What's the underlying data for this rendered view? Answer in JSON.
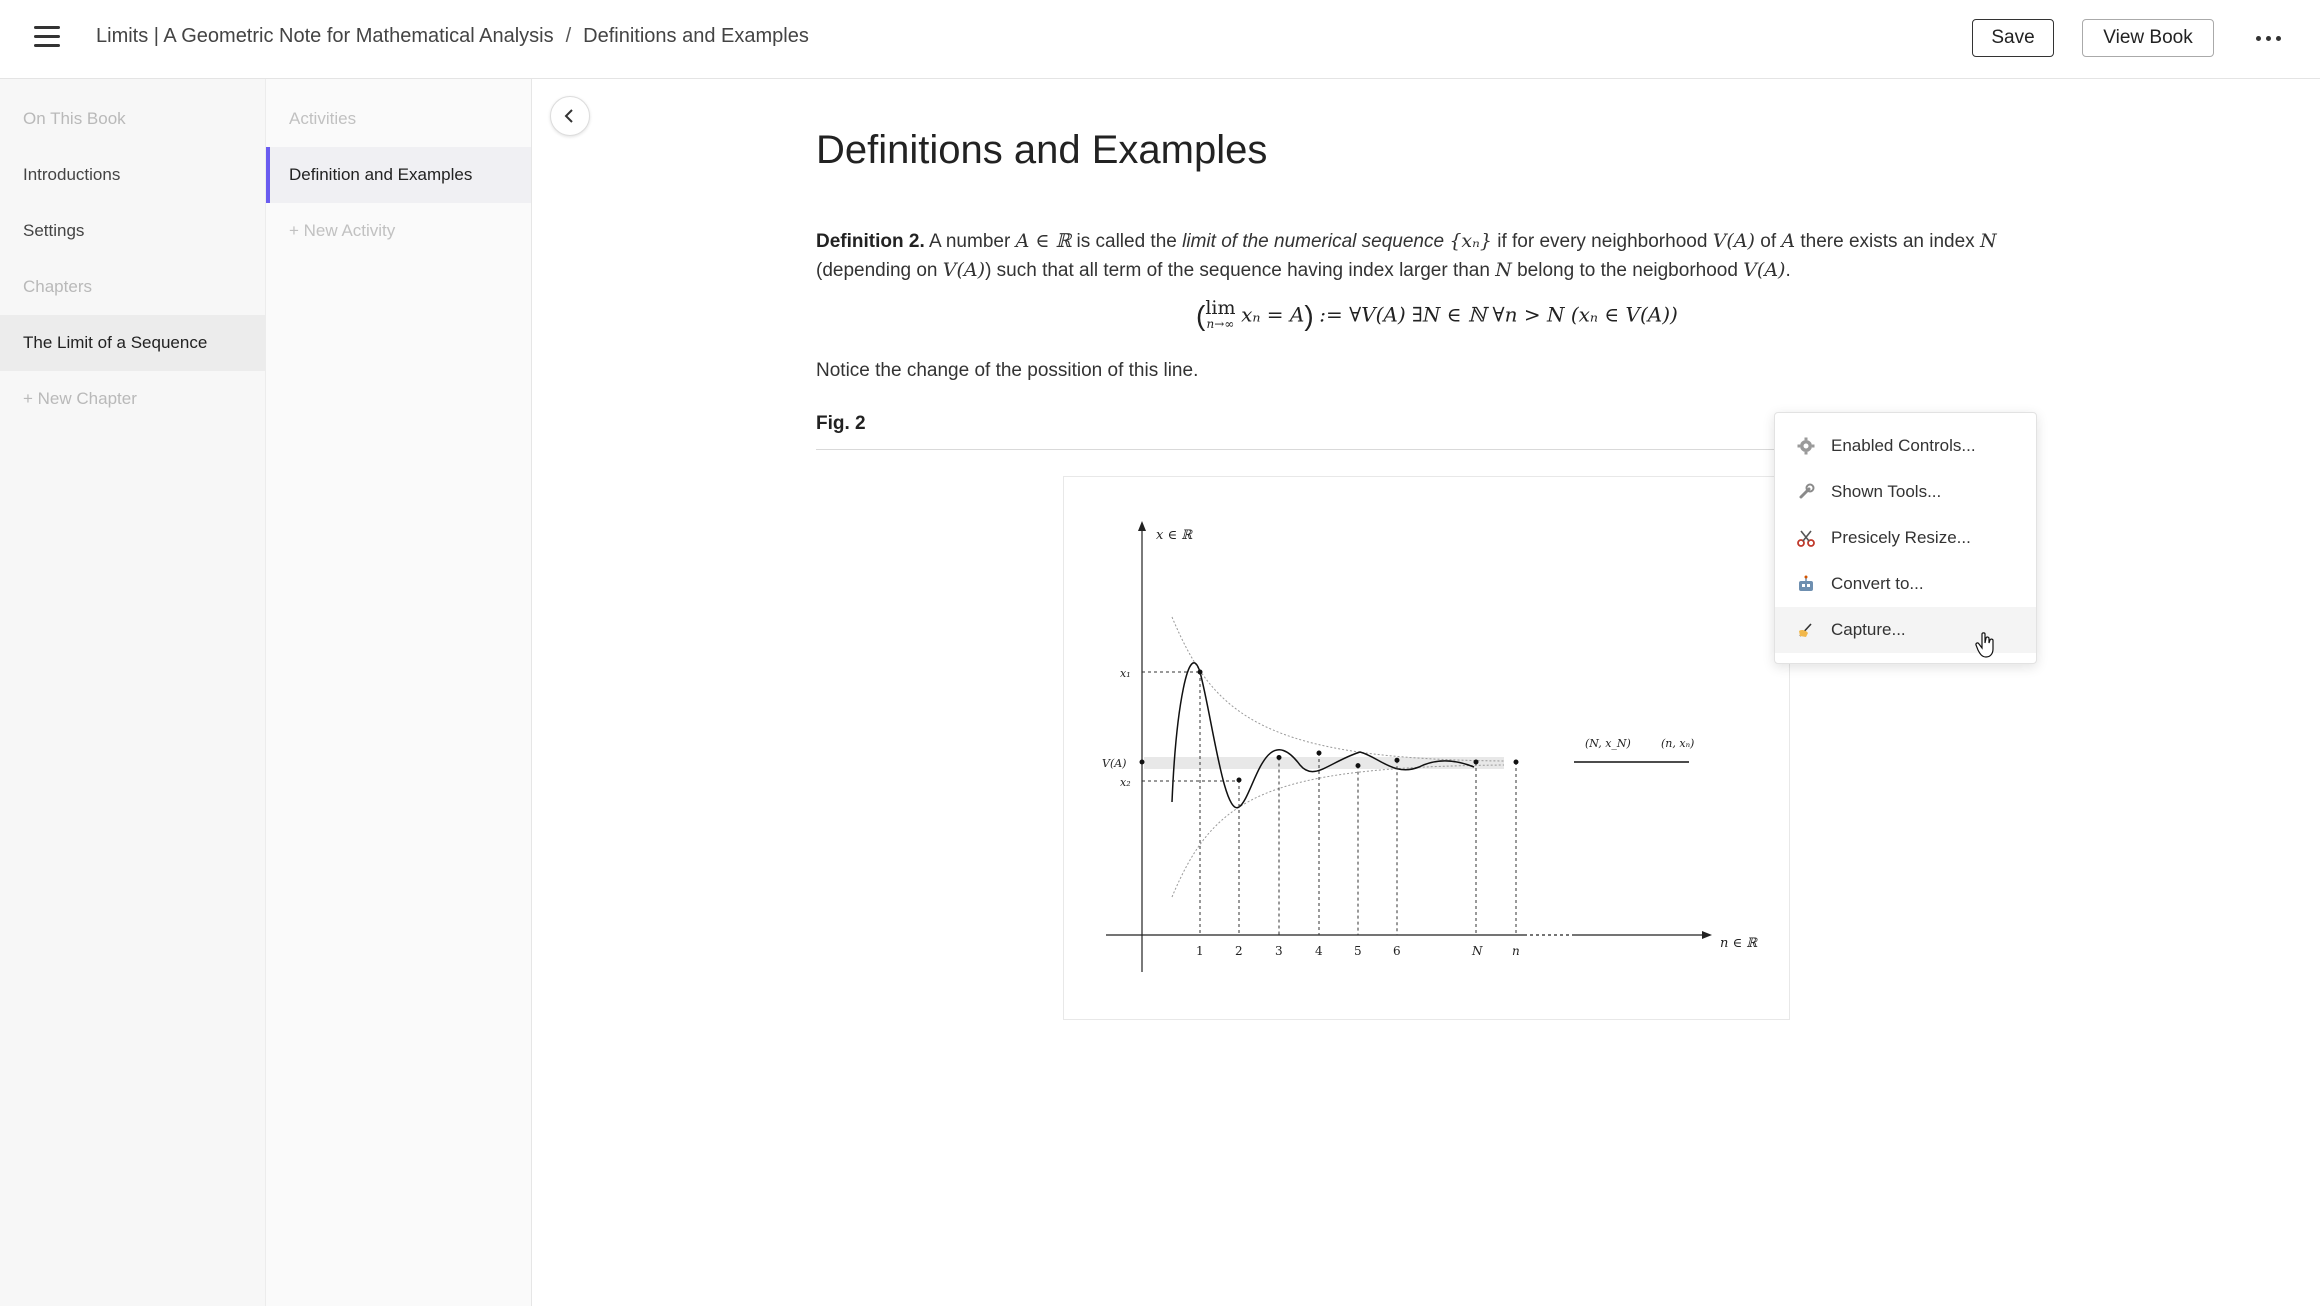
{
  "header": {
    "book_title": "Limits | A Geometric Note for Mathematical Analysis",
    "separator": "/",
    "page": "Definitions and Examples",
    "save_label": "Save",
    "view_book_label": "View Book"
  },
  "sidebar": {
    "items": [
      {
        "label": "On This Book",
        "state": "muted"
      },
      {
        "label": "Introductions",
        "state": "normal"
      },
      {
        "label": "Settings",
        "state": "normal"
      },
      {
        "label": "Chapters",
        "state": "muted"
      },
      {
        "label": "The Limit of a Sequence",
        "state": "active"
      },
      {
        "label": "+ New Chapter",
        "state": "muted"
      }
    ]
  },
  "activities": {
    "heading": "Activities",
    "items": [
      {
        "label": "Definition and Examples",
        "state": "active"
      },
      {
        "label": "+ New Activity",
        "state": "muted"
      }
    ]
  },
  "main": {
    "title": "Definitions and Examples",
    "definition": {
      "lead": "Definition 2.",
      "t1": " A number ",
      "m1": "A ∈ ℝ",
      "t2": " is called the ",
      "em": "limit of the numerical sequence",
      "m2": "{xₙ}",
      "t3": " if for every neighborhood ",
      "m3": "V(A)",
      "t4": " of ",
      "m4": "A",
      "t5": " there exists an index ",
      "m5": "N",
      "t6": " (depending on ",
      "m6": "V(A)",
      "t7": ") such that all term of the sequence having index larger than ",
      "m7": "N",
      "t8": " belong to the neigborhood ",
      "m8": "V(A)",
      "t9": "."
    },
    "formula": {
      "lim_word": "lim",
      "lim_sub": "n→∞",
      "body": "xₙ = A",
      "rest": ":= ∀V(A) ∃N ∈ ℕ ∀n > N  (xₙ ∈ V(A))"
    },
    "notice": "Notice the change of the possition of this line.",
    "figure_label": "Fig. 2"
  },
  "chart_data": {
    "type": "line",
    "title": "",
    "xlabel": "n ∈ ℝ",
    "ylabel": "x ∈ ℝ",
    "x_ticks": [
      "1",
      "2",
      "3",
      "4",
      "5",
      "6",
      "N",
      "n"
    ],
    "y_labels": [
      "x₁",
      "V(A)",
      "x₂"
    ],
    "point_labels": [
      "(N, x_N)",
      "(n, xₙ)"
    ],
    "series": [
      {
        "values": [
          1.0,
          -0.2,
          0.05,
          0.1,
          -0.04,
          0.02
        ]
      }
    ]
  },
  "context_menu": {
    "items": [
      {
        "label": "Enabled Controls...",
        "icon": "gear-icon"
      },
      {
        "label": "Shown Tools...",
        "icon": "wrench-icon"
      },
      {
        "label": "Presicely Resize...",
        "icon": "scissors-icon"
      },
      {
        "label": "Convert to...",
        "icon": "robot-icon"
      },
      {
        "label": "Capture...",
        "icon": "writing-hand-icon"
      }
    ]
  }
}
